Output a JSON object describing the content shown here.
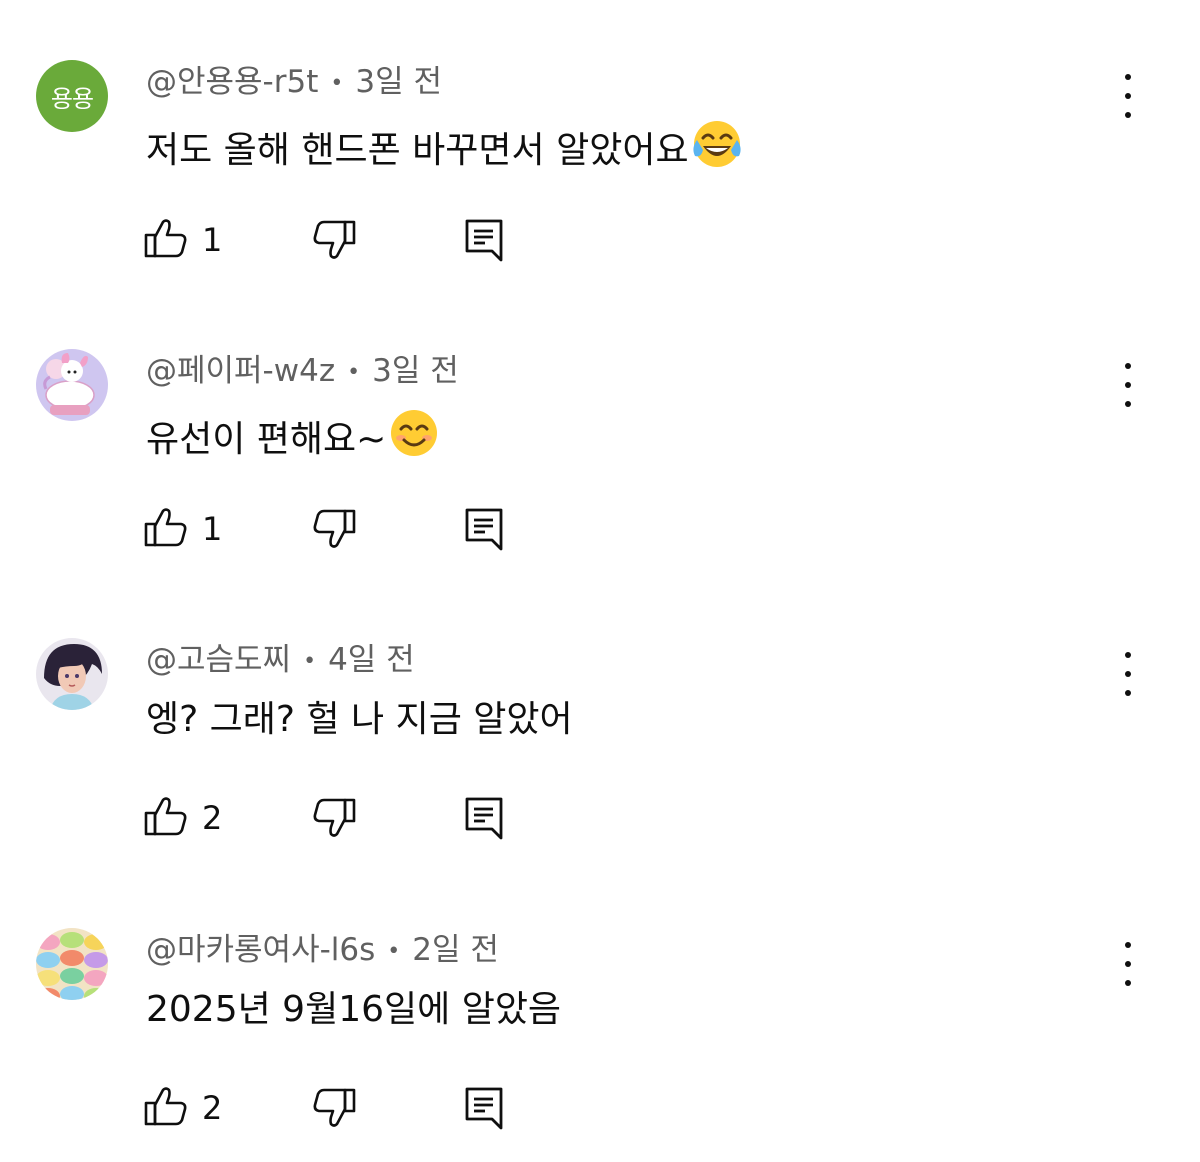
{
  "comments": [
    {
      "handle": "@안용용-r5t",
      "separator": "•",
      "time": "3일 전",
      "text": "저도 올해 핸드폰 바꾸면서 알았어요",
      "emoji": "face-with-tears-of-joy",
      "likes": "1",
      "avatar": {
        "type": "text",
        "label": "용용",
        "color": "#6aaa3a"
      }
    },
    {
      "handle": "@페이퍼-w4z",
      "separator": "•",
      "time": "3일 전",
      "text": "유선이 편해요~",
      "emoji": "smiling-face-with-smiling-eyes",
      "likes": "1",
      "avatar": {
        "type": "image",
        "description": "my-melody-unicorn"
      }
    },
    {
      "handle": "@고슴도찌",
      "separator": "•",
      "time": "4일 전",
      "text": "엥? 그래? 헐 나 지금 알았어",
      "emoji": "",
      "likes": "2",
      "avatar": {
        "type": "image",
        "description": "anime-girl"
      }
    },
    {
      "handle": "@마카롱여사-l6s",
      "separator": "•",
      "time": "2일 전",
      "text": "2025년 9월16일에 알았음",
      "emoji": "",
      "likes": "2",
      "avatar": {
        "type": "image",
        "description": "macarons"
      }
    }
  ],
  "icons": {
    "like": "thumbs-up-icon",
    "dislike": "thumbs-down-icon",
    "reply": "reply-comment-icon",
    "more": "more-vertical-icon"
  },
  "colors": {
    "text": "#0f0f0f",
    "meta": "#606060",
    "background": "#ffffff"
  }
}
